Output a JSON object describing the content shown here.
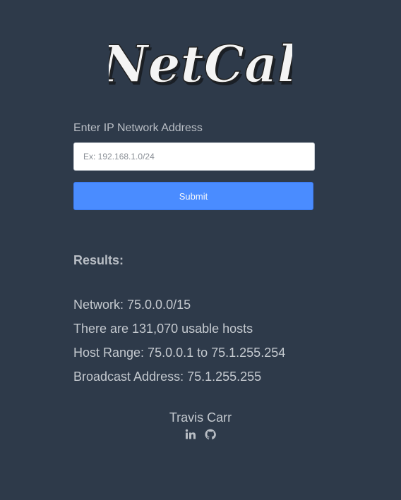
{
  "logo": {
    "text": "NetCal"
  },
  "form": {
    "label": "Enter IP Network Address",
    "placeholder": "Ex: 192.168.1.0/24",
    "value": "",
    "submit_label": "Submit"
  },
  "results": {
    "heading": "Results:",
    "network": "Network: 75.0.0.0/15",
    "hosts": "There are 131,070 usable hosts",
    "host_range": "Host Range: 75.0.0.1 to 75.1.255.254",
    "broadcast": "Broadcast Address: 75.1.255.255"
  },
  "footer": {
    "author": "Travis Carr",
    "links": [
      {
        "icon": "linkedin-icon"
      },
      {
        "icon": "github-icon"
      }
    ]
  },
  "colors": {
    "background": "#2e3a4a",
    "accent": "#4a8cff",
    "text": "#c4c9cf"
  }
}
